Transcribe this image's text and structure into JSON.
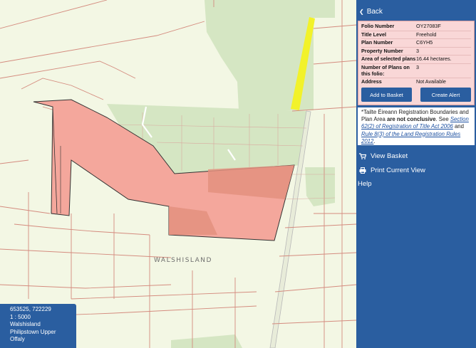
{
  "panel": {
    "back_label": "Back",
    "details": [
      {
        "label": "Folio Number",
        "value": "OY27083F"
      },
      {
        "label": "Title Level",
        "value": "Freehold"
      },
      {
        "label": "Plan Number",
        "value": "C6YH5"
      },
      {
        "label": "Property Number",
        "value": "3"
      },
      {
        "label": "Area of selected plans",
        "value": "16.44 hectares."
      },
      {
        "label": "Number of Plans on this folio:",
        "value": "3"
      },
      {
        "label": "Address",
        "value": "Not Available"
      }
    ],
    "add_basket_label": "Add to Basket",
    "create_alert_label": "Create Alert",
    "notice": {
      "prefix": "*Tailte Éireann Registration Boundaries and Plan Area ",
      "bold": "are not conclusive",
      "mid": ". See ",
      "link1": "Section 62(2) of Registration of Title Act 2006",
      "and": " and ",
      "link2": "Rule 8(3) of the Land Registration Rules 2012",
      "suffix": "."
    },
    "view_basket_label": "View Basket",
    "print_label": "Print Current View",
    "help_label": "Help"
  },
  "map": {
    "place_label": "WALSHISLAND",
    "info": {
      "coords": "653525, 722229",
      "scale": "1 : 5000",
      "townland": "Walshisland",
      "barony": "Philipstown Upper",
      "county": "Offaly"
    }
  },
  "colors": {
    "panel_bg": "#2a5ea0",
    "map_bg": "#f3f7e4",
    "parcel_fill": "#f4a79c",
    "parcel_dark": "#e3907f",
    "forest": "#d5e6c3",
    "road_yellow": "#f2f22a"
  }
}
